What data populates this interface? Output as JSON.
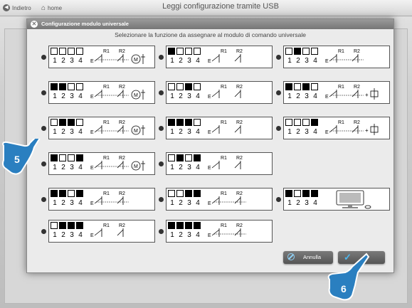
{
  "topbar": {
    "back_label": "Indietro",
    "home_label": "home",
    "title": "Leggi configurazione tramite USB"
  },
  "dialog": {
    "title": "Configurazione modulo universale",
    "prompt": "Selezionare la funzione da assegnare al modulo di comando universale",
    "cancel_label": "Annulla",
    "ok_icon": "checkmark-icon",
    "options": [
      {
        "switches": [
          0,
          0,
          0,
          0
        ],
        "diagram": "dimmer-split",
        "r1": "R1",
        "r2": "R2"
      },
      {
        "switches": [
          1,
          0,
          0,
          0
        ],
        "diagram": "two-e",
        "r1": "R1",
        "r2": "R2"
      },
      {
        "switches": [
          0,
          1,
          0,
          0
        ],
        "diagram": "one-e-dashed",
        "r1": "R1",
        "r2": "R2"
      },
      {
        "switches": [
          1,
          1,
          0,
          0
        ],
        "diagram": "dimmer-split",
        "r1": "R1",
        "r2": "R2"
      },
      {
        "switches": [
          0,
          0,
          1,
          0
        ],
        "diagram": "two-e",
        "r1": "R1",
        "r2": "R2"
      },
      {
        "switches": [
          1,
          0,
          1,
          0
        ],
        "diagram": "relay",
        "r1": "R1",
        "r2": "R2"
      },
      {
        "switches": [
          0,
          1,
          1,
          0
        ],
        "diagram": "dimmer-two",
        "r1": "R1",
        "r2": "R2"
      },
      {
        "switches": [
          1,
          1,
          1,
          0
        ],
        "diagram": "two-e",
        "r1": "R1",
        "r2": "R2"
      },
      {
        "switches": [
          0,
          0,
          0,
          1
        ],
        "diagram": "relay-two",
        "r1": "R1",
        "r2": "R2"
      },
      {
        "switches": [
          1,
          0,
          0,
          1
        ],
        "diagram": "dimmer-two",
        "r1": "R1",
        "r2": "R2"
      },
      {
        "switches": [
          0,
          1,
          0,
          1
        ],
        "diagram": "two-e-plain",
        "r1": "R1",
        "r2": "R2"
      },
      {
        "switches": [
          1,
          1,
          0,
          1
        ],
        "diagram": "one-e-split",
        "r1": "R1",
        "r2": "R2"
      },
      {
        "switches": [
          0,
          0,
          1,
          1
        ],
        "diagram": "one-e-dashed",
        "r1": "R1",
        "r2": "R2"
      },
      {
        "switches": [
          1,
          0,
          1,
          1
        ],
        "diagram": "computer",
        "r1": "",
        "r2": ""
      },
      {
        "switches": [
          0,
          1,
          1,
          1
        ],
        "diagram": "two-e-plain",
        "r1": "R1",
        "r2": "R2"
      },
      {
        "switches": [
          1,
          1,
          1,
          1
        ],
        "diagram": "one-e-dashed",
        "r1": "R1",
        "r2": "R2"
      }
    ]
  },
  "callouts": {
    "step5": "5",
    "step6": "6"
  },
  "nums": [
    "1",
    "2",
    "3",
    "4"
  ]
}
